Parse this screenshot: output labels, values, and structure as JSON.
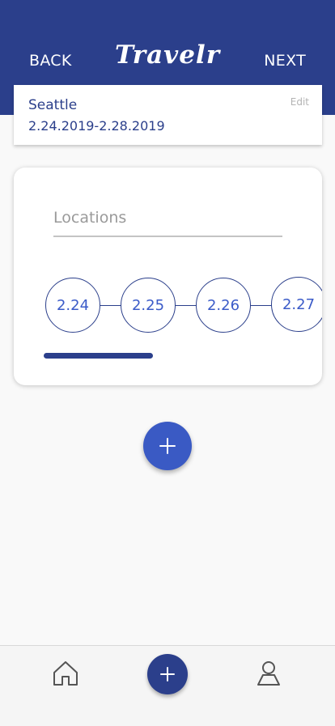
{
  "header": {
    "back_label": "BACK",
    "logo_text": "Travelr",
    "next_label": "NEXT"
  },
  "trip": {
    "city": "Seattle",
    "dates": "2.24.2019-2.28.2019",
    "edit_label": "Edit"
  },
  "locations": {
    "placeholder": "Locations",
    "days": [
      "2.24",
      "2.25",
      "2.26",
      "2.27"
    ],
    "progress_fraction": 0.35
  },
  "icons": {
    "add": "plus-icon",
    "home": "home-icon",
    "profile": "user-icon"
  },
  "colors": {
    "brand": "#2b3f8b",
    "accent": "#3a5ac4"
  }
}
